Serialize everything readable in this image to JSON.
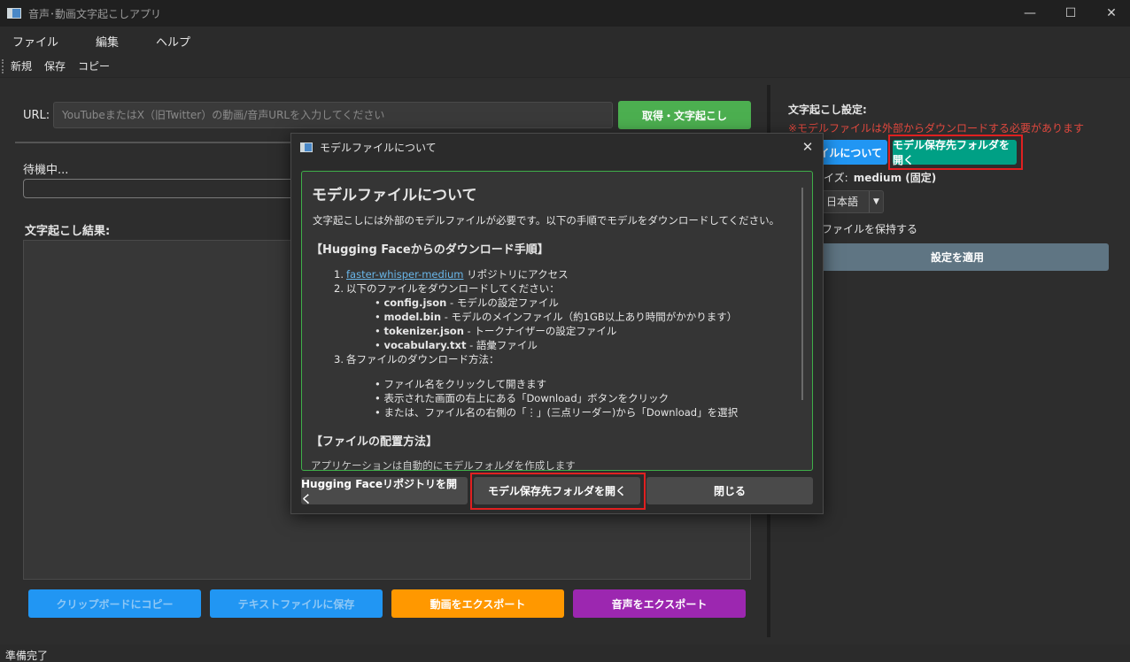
{
  "window": {
    "title": "音声･動画文字起こしアプリ",
    "min_glyph": "—",
    "max_glyph": "☐",
    "close_glyph": "✕"
  },
  "menubar": {
    "items": [
      "ファイル",
      "編集",
      "ヘルプ"
    ]
  },
  "toolbar": {
    "items": [
      "新規",
      "保存",
      "コピー"
    ]
  },
  "main": {
    "url_label": "URL:",
    "url_placeholder": "YouTubeまたはX（旧Twitter）の動画/音声URLを入力してください",
    "fetch_button": "取得・文字起こし",
    "status": "待機中...",
    "result_label": "文字起こし結果:",
    "buttons": {
      "copy": "クリップボードにコピー",
      "save_text": "テキストファイルに保存",
      "export_video": "動画をエクスポート",
      "export_audio": "音声をエクスポート"
    }
  },
  "settings": {
    "title": "文字起こし設定:",
    "warning": "※モデルファイルは外部からダウンロードする必要があります",
    "model_info_button": "ファイルについて",
    "open_folder_button": "モデル保存先フォルダを開く",
    "size_label": "イズ:",
    "size_value": "medium (固定)",
    "language": "日本語",
    "keep_file": "ファイルを保持する",
    "apply_button": "設定を適用"
  },
  "statusbar": {
    "text": "準備完了"
  },
  "dialog": {
    "title": "モデルファイルについて",
    "heading": "モデルファイルについて",
    "intro": "文字起こしには外部のモデルファイルが必要です。以下の手順でモデルをダウンロードしてください。",
    "section1": "【Hugging Faceからのダウンロード手順】",
    "step1_num": "1.",
    "step1_link": "faster-whisper-medium",
    "step1_text": " リポジトリにアクセス",
    "step2_num": "2.",
    "step2_text": "以下のファイルをダウンロードしてください：",
    "files": [
      {
        "name": "config.json",
        "desc": " - モデルの設定ファイル"
      },
      {
        "name": "model.bin",
        "desc": " - モデルのメインファイル（約1GB以上あり時間がかかります）"
      },
      {
        "name": "tokenizer.json",
        "desc": " - トークナイザーの設定ファイル"
      },
      {
        "name": "vocabulary.txt",
        "desc": " - 語彙ファイル"
      }
    ],
    "step3_num": "3.",
    "step3_text": "各ファイルのダウンロード方法：",
    "methods": [
      "ファイル名をクリックして開きます",
      "表示された画面の右上にある「Download」ボタンをクリック",
      "または、ファイル名の右側の「⋮」(三点リーダー)から「Download」を選択"
    ],
    "section2": "【ファイルの配置方法】",
    "cut_text": "アプリケーションは自動的にモデルフォルダを作成します",
    "buttons": {
      "open_repo": "Hugging Faceリポジトリを開く",
      "open_folder": "モデル保存先フォルダを開く",
      "close": "閉じる"
    }
  }
}
